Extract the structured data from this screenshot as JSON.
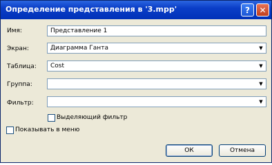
{
  "window": {
    "title": "Определение представления в '3.mpp'"
  },
  "titlebar": {
    "help": "?",
    "close": "✕"
  },
  "form": {
    "name_label": "Имя:",
    "name_value": "Представление 1",
    "screen_label": "Экран:",
    "screen_value": "Диаграмма Ганта",
    "table_label": "Таблица:",
    "table_value": "Cost",
    "group_label": "Группа:",
    "group_value": "",
    "filter_label": "Фильтр:",
    "filter_value": "",
    "highlight_filter_label": "Выделяющий фильтр",
    "highlight_filter_checked": false,
    "show_in_menu_label": "Показывать в меню",
    "show_in_menu_checked": false
  },
  "buttons": {
    "ok": "ОК",
    "cancel": "Отмена"
  },
  "icons": {
    "dropdown": "chevron-down-icon",
    "help": "help-icon",
    "close": "close-icon"
  }
}
